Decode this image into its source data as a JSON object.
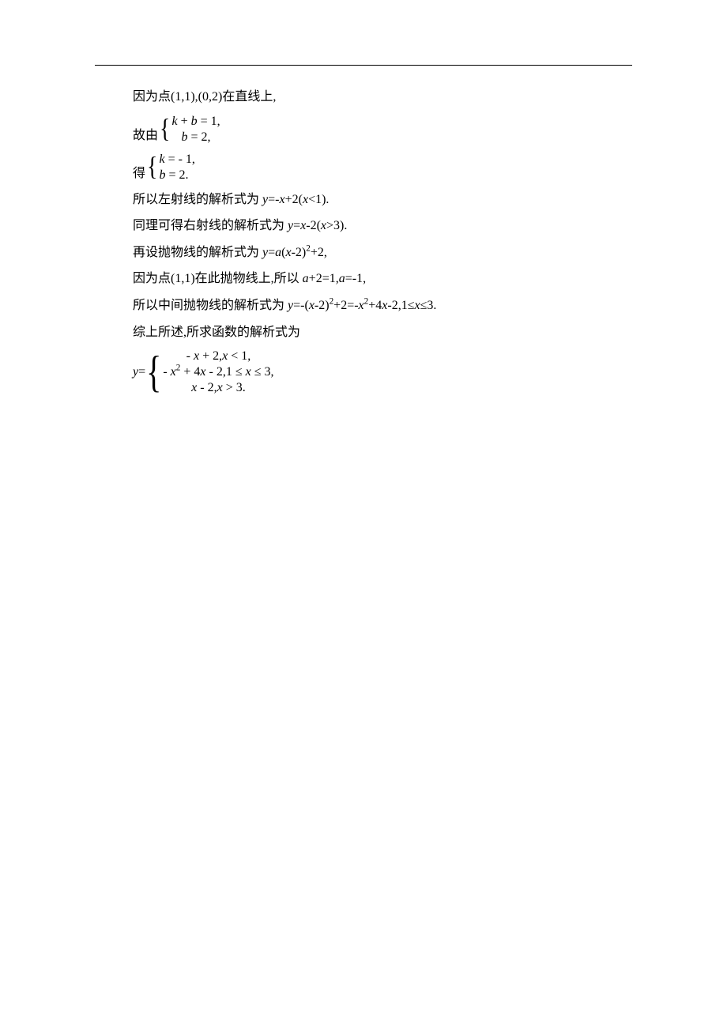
{
  "lines": {
    "l1": "因为点(1,1),(0,2)在直线上,",
    "l2_prefix": "故由",
    "l2_sys1": "k + b = 1,",
    "l2_sys2": "b = 2,",
    "l3_prefix": "得",
    "l3_sys1": "k = - 1,",
    "l3_sys2": "b = 2.",
    "l4_pre": "所以左射线的解析式为 ",
    "l4_eq": "y=-x+2(x<1).",
    "l5_pre": "同理可得右射线的解析式为 ",
    "l5_eq": "y=x-2(x>3).",
    "l6_pre": "再设抛物线的解析式为 ",
    "l6_eq": "y=a(x-2)²+2,",
    "l7_a": "因为点(1,1)在此抛物线上,所以 ",
    "l7_b": "a+2=1,a=-1,",
    "l8_a": "所以中间抛物线的解析式为 ",
    "l8_b": "y=-(x-2)²+2=-x²+4x-2,1≤x≤3.",
    "l9": "综上所述,所求函数的解析式为",
    "pf_prefix": "y=",
    "pf_r1": "- x + 2, x < 1,",
    "pf_r2": "- x² + 4x - 2, 1 ≤ x ≤ 3,",
    "pf_r3": "x - 2, x > 3."
  }
}
